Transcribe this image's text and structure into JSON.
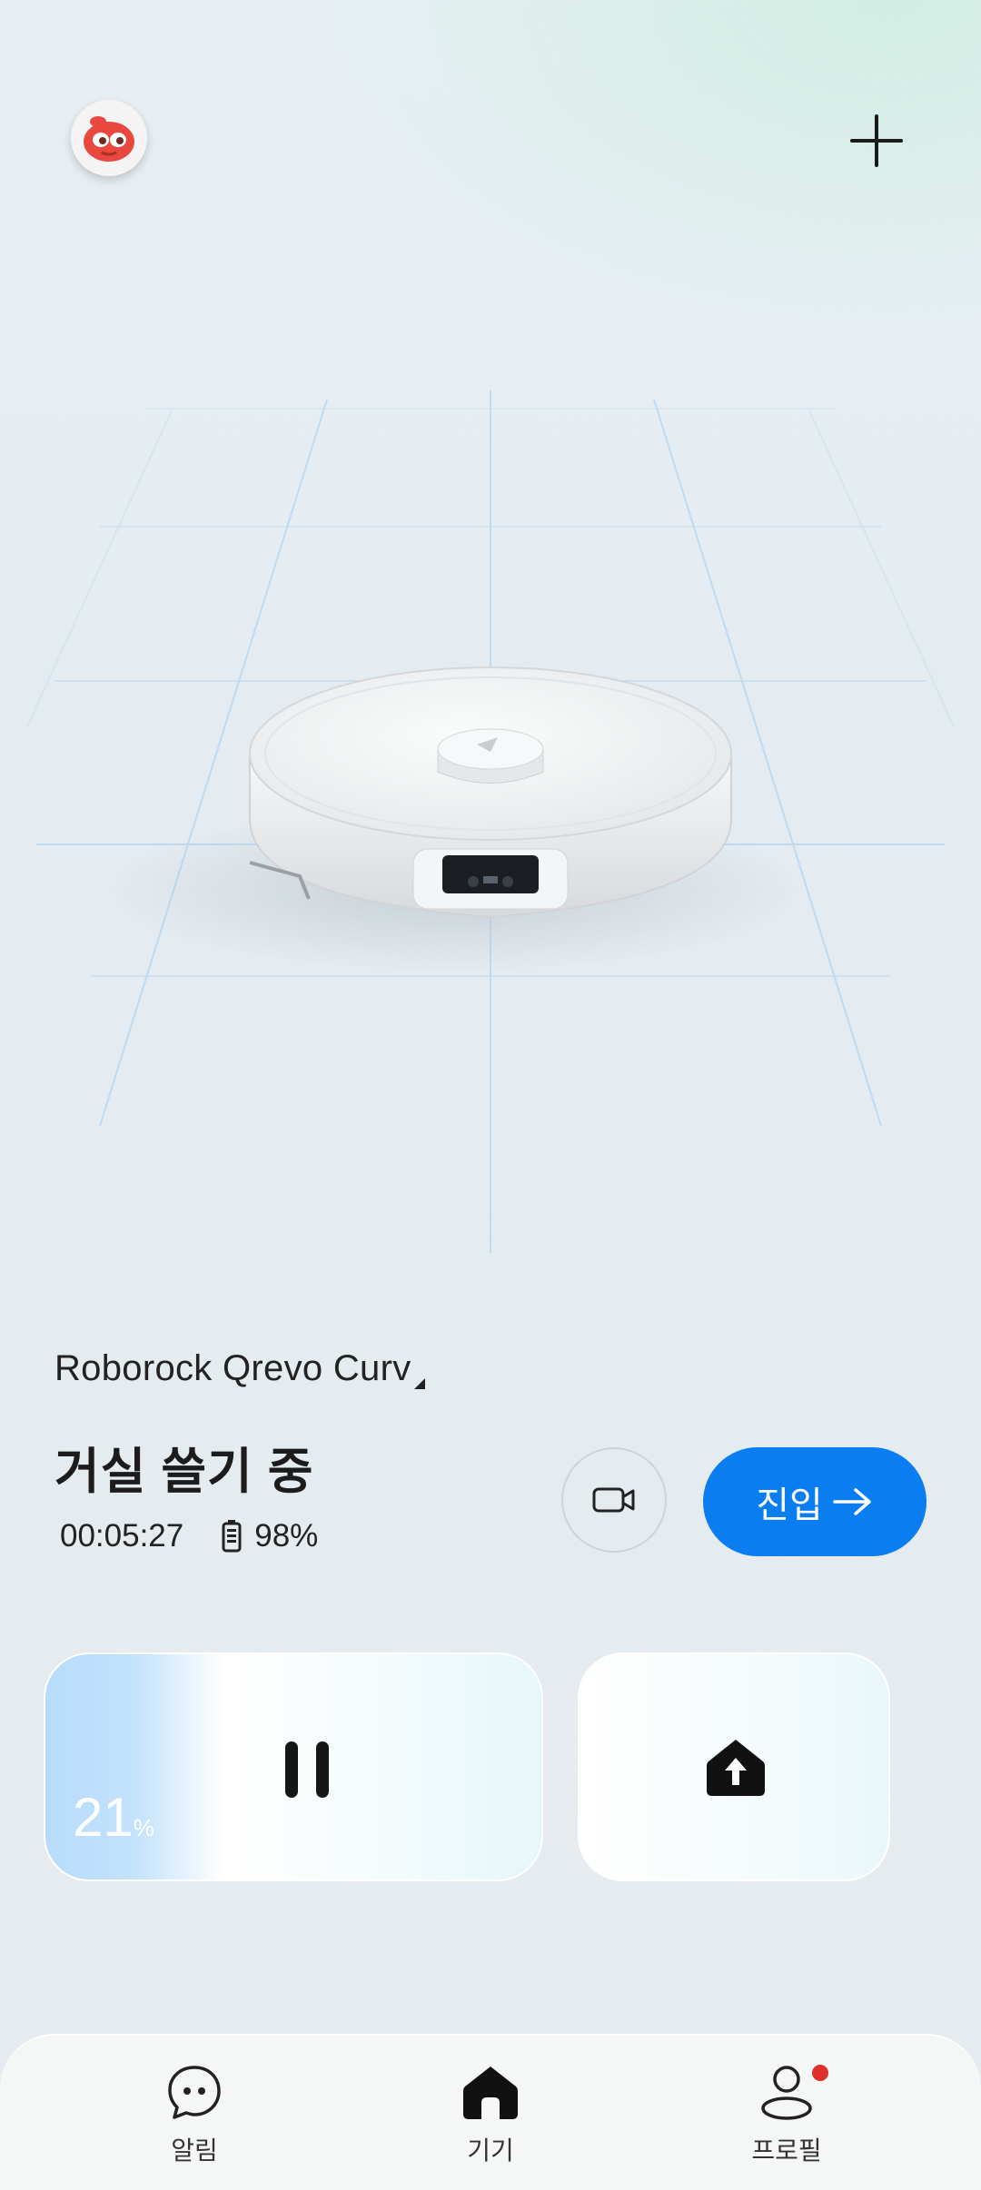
{
  "header": {
    "avatar_icon": "mascot-avatar-icon",
    "add_icon": "plus-icon"
  },
  "device": {
    "name": "Roborock Qrevo Curv",
    "status": "거실 쓸기 중",
    "elapsed": "00:05:27",
    "battery": "98%"
  },
  "actions": {
    "camera_icon": "video-camera-icon",
    "enter_label": "진입"
  },
  "cards": {
    "progress_value": "21",
    "progress_unit": "%",
    "pause_icon": "pause-icon",
    "home_icon": "return-to-dock-icon"
  },
  "nav": {
    "items": [
      {
        "label": "알림",
        "icon": "chat-bubble-icon"
      },
      {
        "label": "기기",
        "icon": "home-icon"
      },
      {
        "label": "프로필",
        "icon": "profile-icon"
      }
    ]
  },
  "colors": {
    "accent": "#0a7df0",
    "badge": "#e0302c"
  }
}
